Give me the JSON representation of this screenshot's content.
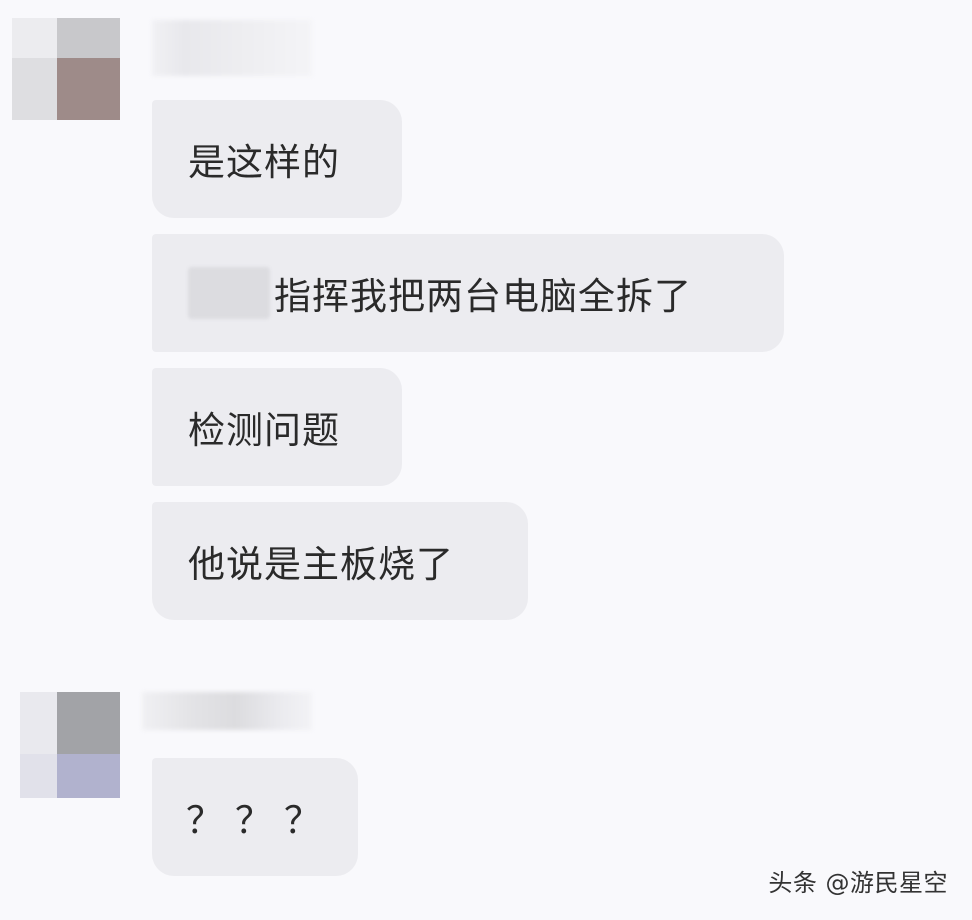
{
  "conversation": {
    "groups": [
      {
        "avatar": "blurred-avatar",
        "messages": [
          {
            "text": "是这样的"
          },
          {
            "text": "指挥我把两台电脑全拆了",
            "has_redacted_prefix": true
          },
          {
            "text": "检测问题"
          },
          {
            "text": "他说是主板烧了"
          }
        ]
      },
      {
        "avatar": "blurred-avatar",
        "messages": [
          {
            "text": "？？？"
          }
        ]
      }
    ]
  },
  "watermark": {
    "text": "头条 @游民星空"
  },
  "colors": {
    "background": "#f9f9fc",
    "bubble": "#ececf0",
    "text": "#2a2a2a"
  }
}
